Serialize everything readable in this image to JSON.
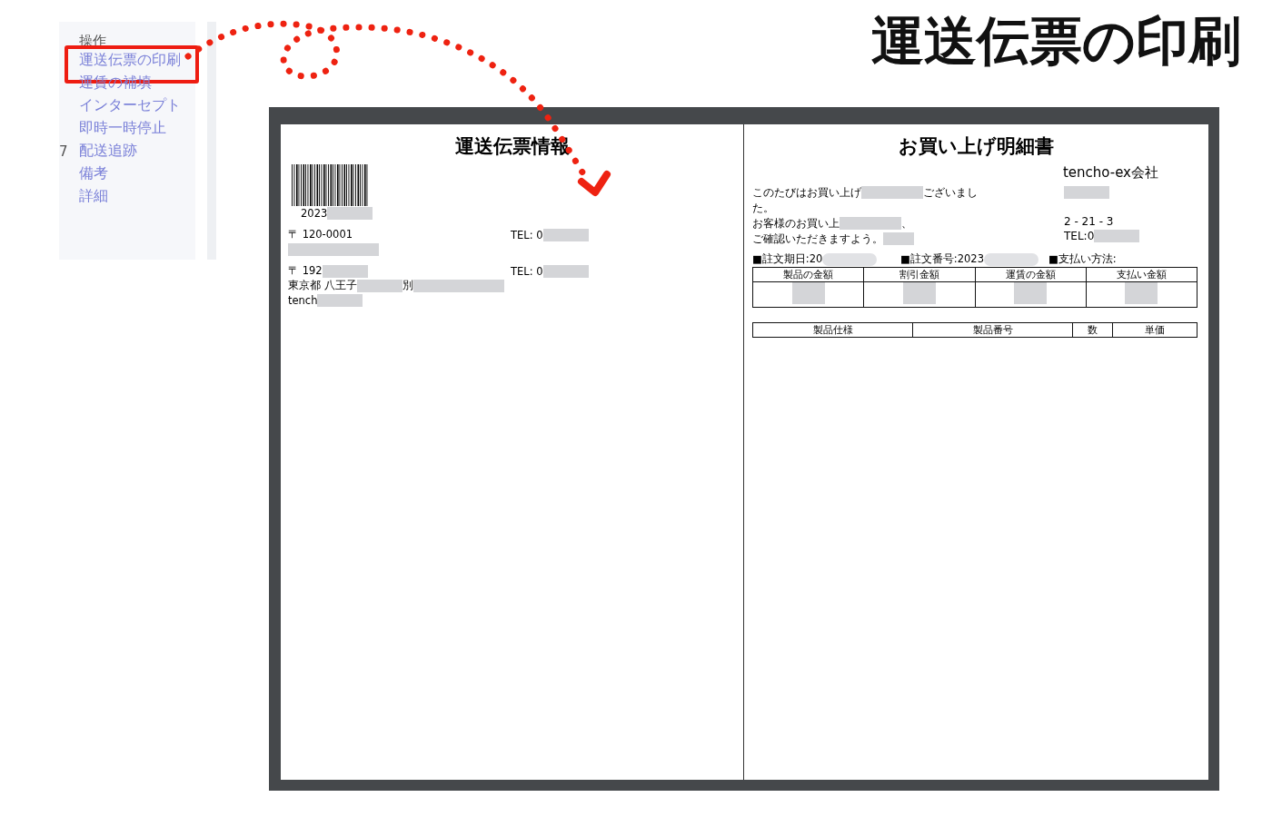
{
  "heading": "運送伝票の印刷",
  "sidebar": {
    "header": "操作",
    "items": [
      {
        "label": "運送伝票の印刷",
        "highlighted": true
      },
      {
        "label": "運賃の補填",
        "highlighted": false
      },
      {
        "label": "インターセプト",
        "highlighted": false
      },
      {
        "label": "即時一時停止",
        "highlighted": false
      },
      {
        "label": "配送追跡",
        "highlighted": false,
        "column_1": "7"
      },
      {
        "label": "備考",
        "highlighted": false
      },
      {
        "label": "詳細",
        "highlighted": false
      }
    ]
  },
  "left_page": {
    "title": "運送伝票情報",
    "barcode_number": [
      {
        "kind": "text",
        "text": "2023"
      },
      {
        "kind": "blur"
      }
    ],
    "lines": [
      {
        "left": [
          {
            "kind": "text",
            "text": "〒 120-0001"
          }
        ],
        "right": [
          {
            "kind": "text",
            "text": "TEL: 0"
          },
          {
            "kind": "blur"
          }
        ]
      },
      {
        "left": [
          {
            "kind": "blur"
          },
          {
            "kind": "blur"
          }
        ]
      },
      {
        "left": [
          {
            "kind": "text",
            "text": "〒 192"
          },
          {
            "kind": "blur"
          }
        ],
        "right": [
          {
            "kind": "text",
            "text": "TEL: 0"
          },
          {
            "kind": "blur"
          }
        ]
      },
      {
        "left": [
          {
            "kind": "text",
            "text": "東京都 八王子"
          },
          {
            "kind": "blur"
          },
          {
            "kind": "text",
            "text": "別"
          },
          {
            "kind": "blur"
          },
          {
            "kind": "blur"
          }
        ]
      },
      {
        "left": [
          {
            "kind": "text",
            "text": "tench"
          },
          {
            "kind": "blur"
          }
        ]
      }
    ]
  },
  "right_page": {
    "title": "お買い上げ明細書",
    "company": "tencho-ex会社",
    "message": [
      [
        {
          "kind": "text",
          "text": "このたびはお買い上げ"
        },
        {
          "kind": "blur"
        },
        {
          "kind": "blur"
        },
        {
          "kind": "text",
          "text": "ございまし"
        }
      ],
      [
        {
          "kind": "text",
          "text": "た。"
        }
      ],
      [
        {
          "kind": "text",
          "text": "お客様のお買い上"
        },
        {
          "kind": "blur"
        },
        {
          "kind": "blur"
        },
        {
          "kind": "text",
          "text": "、"
        }
      ],
      [
        {
          "kind": "text",
          "text": "ご確認いただきますよう。"
        },
        {
          "kind": "blur"
        }
      ]
    ],
    "address": [
      [
        {
          "kind": "blur"
        }
      ],
      [
        {
          "kind": "text",
          "text": "2 - 21 - 3"
        }
      ],
      [
        {
          "kind": "text",
          "text": "TEL:0"
        },
        {
          "kind": "blur"
        }
      ]
    ],
    "order_info": [
      [
        {
          "kind": "text",
          "text": "■註文期日:20"
        },
        {
          "kind": "blur"
        }
      ],
      [
        {
          "kind": "text",
          "text": "■註文番号:2023"
        },
        {
          "kind": "blur"
        }
      ],
      [
        {
          "kind": "text",
          "text": "■支払い方法:"
        }
      ]
    ],
    "totals_table": {
      "columns": [
        "製品の金額",
        "割引金額",
        "運賃の金額",
        "支払い金額"
      ]
    },
    "items_table": {
      "columns": [
        "製品仕様",
        "製品番号",
        "数",
        "単価"
      ]
    }
  }
}
